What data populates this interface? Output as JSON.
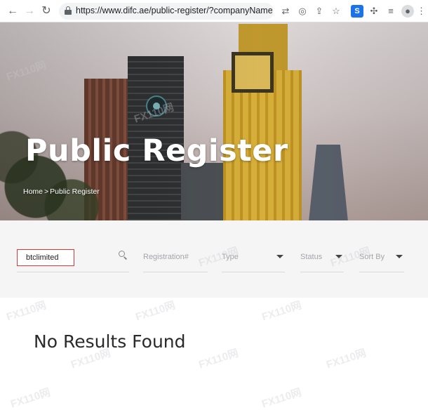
{
  "browser": {
    "url": "https://www.difc.ae/public-register/?companyName=...",
    "back_icon": "←",
    "forward_icon": "→",
    "reload_icon": "↻",
    "toolbar_icons": [
      "translate-icon",
      "eye-off-icon",
      "share-icon",
      "star-icon",
      "s-extension-icon",
      "puzzle-icon",
      "reading-list-icon",
      "profile-icon",
      "more-icon"
    ]
  },
  "hero": {
    "title": "Public Register",
    "breadcrumb": {
      "home": "Home",
      "separator": ">",
      "current": "Public Register"
    }
  },
  "filters": {
    "search_value": "btclimited",
    "registration_placeholder": "Registration#",
    "type_placeholder": "Type",
    "status_placeholder": "Status",
    "sort_placeholder": "Sort By"
  },
  "results": {
    "message": "No Results Found"
  },
  "watermark": {
    "text": "FX110网"
  },
  "colors": {
    "highlight": "#d63b3b",
    "hero_text": "#ffffff",
    "filter_bg": "#f5f5f6"
  }
}
